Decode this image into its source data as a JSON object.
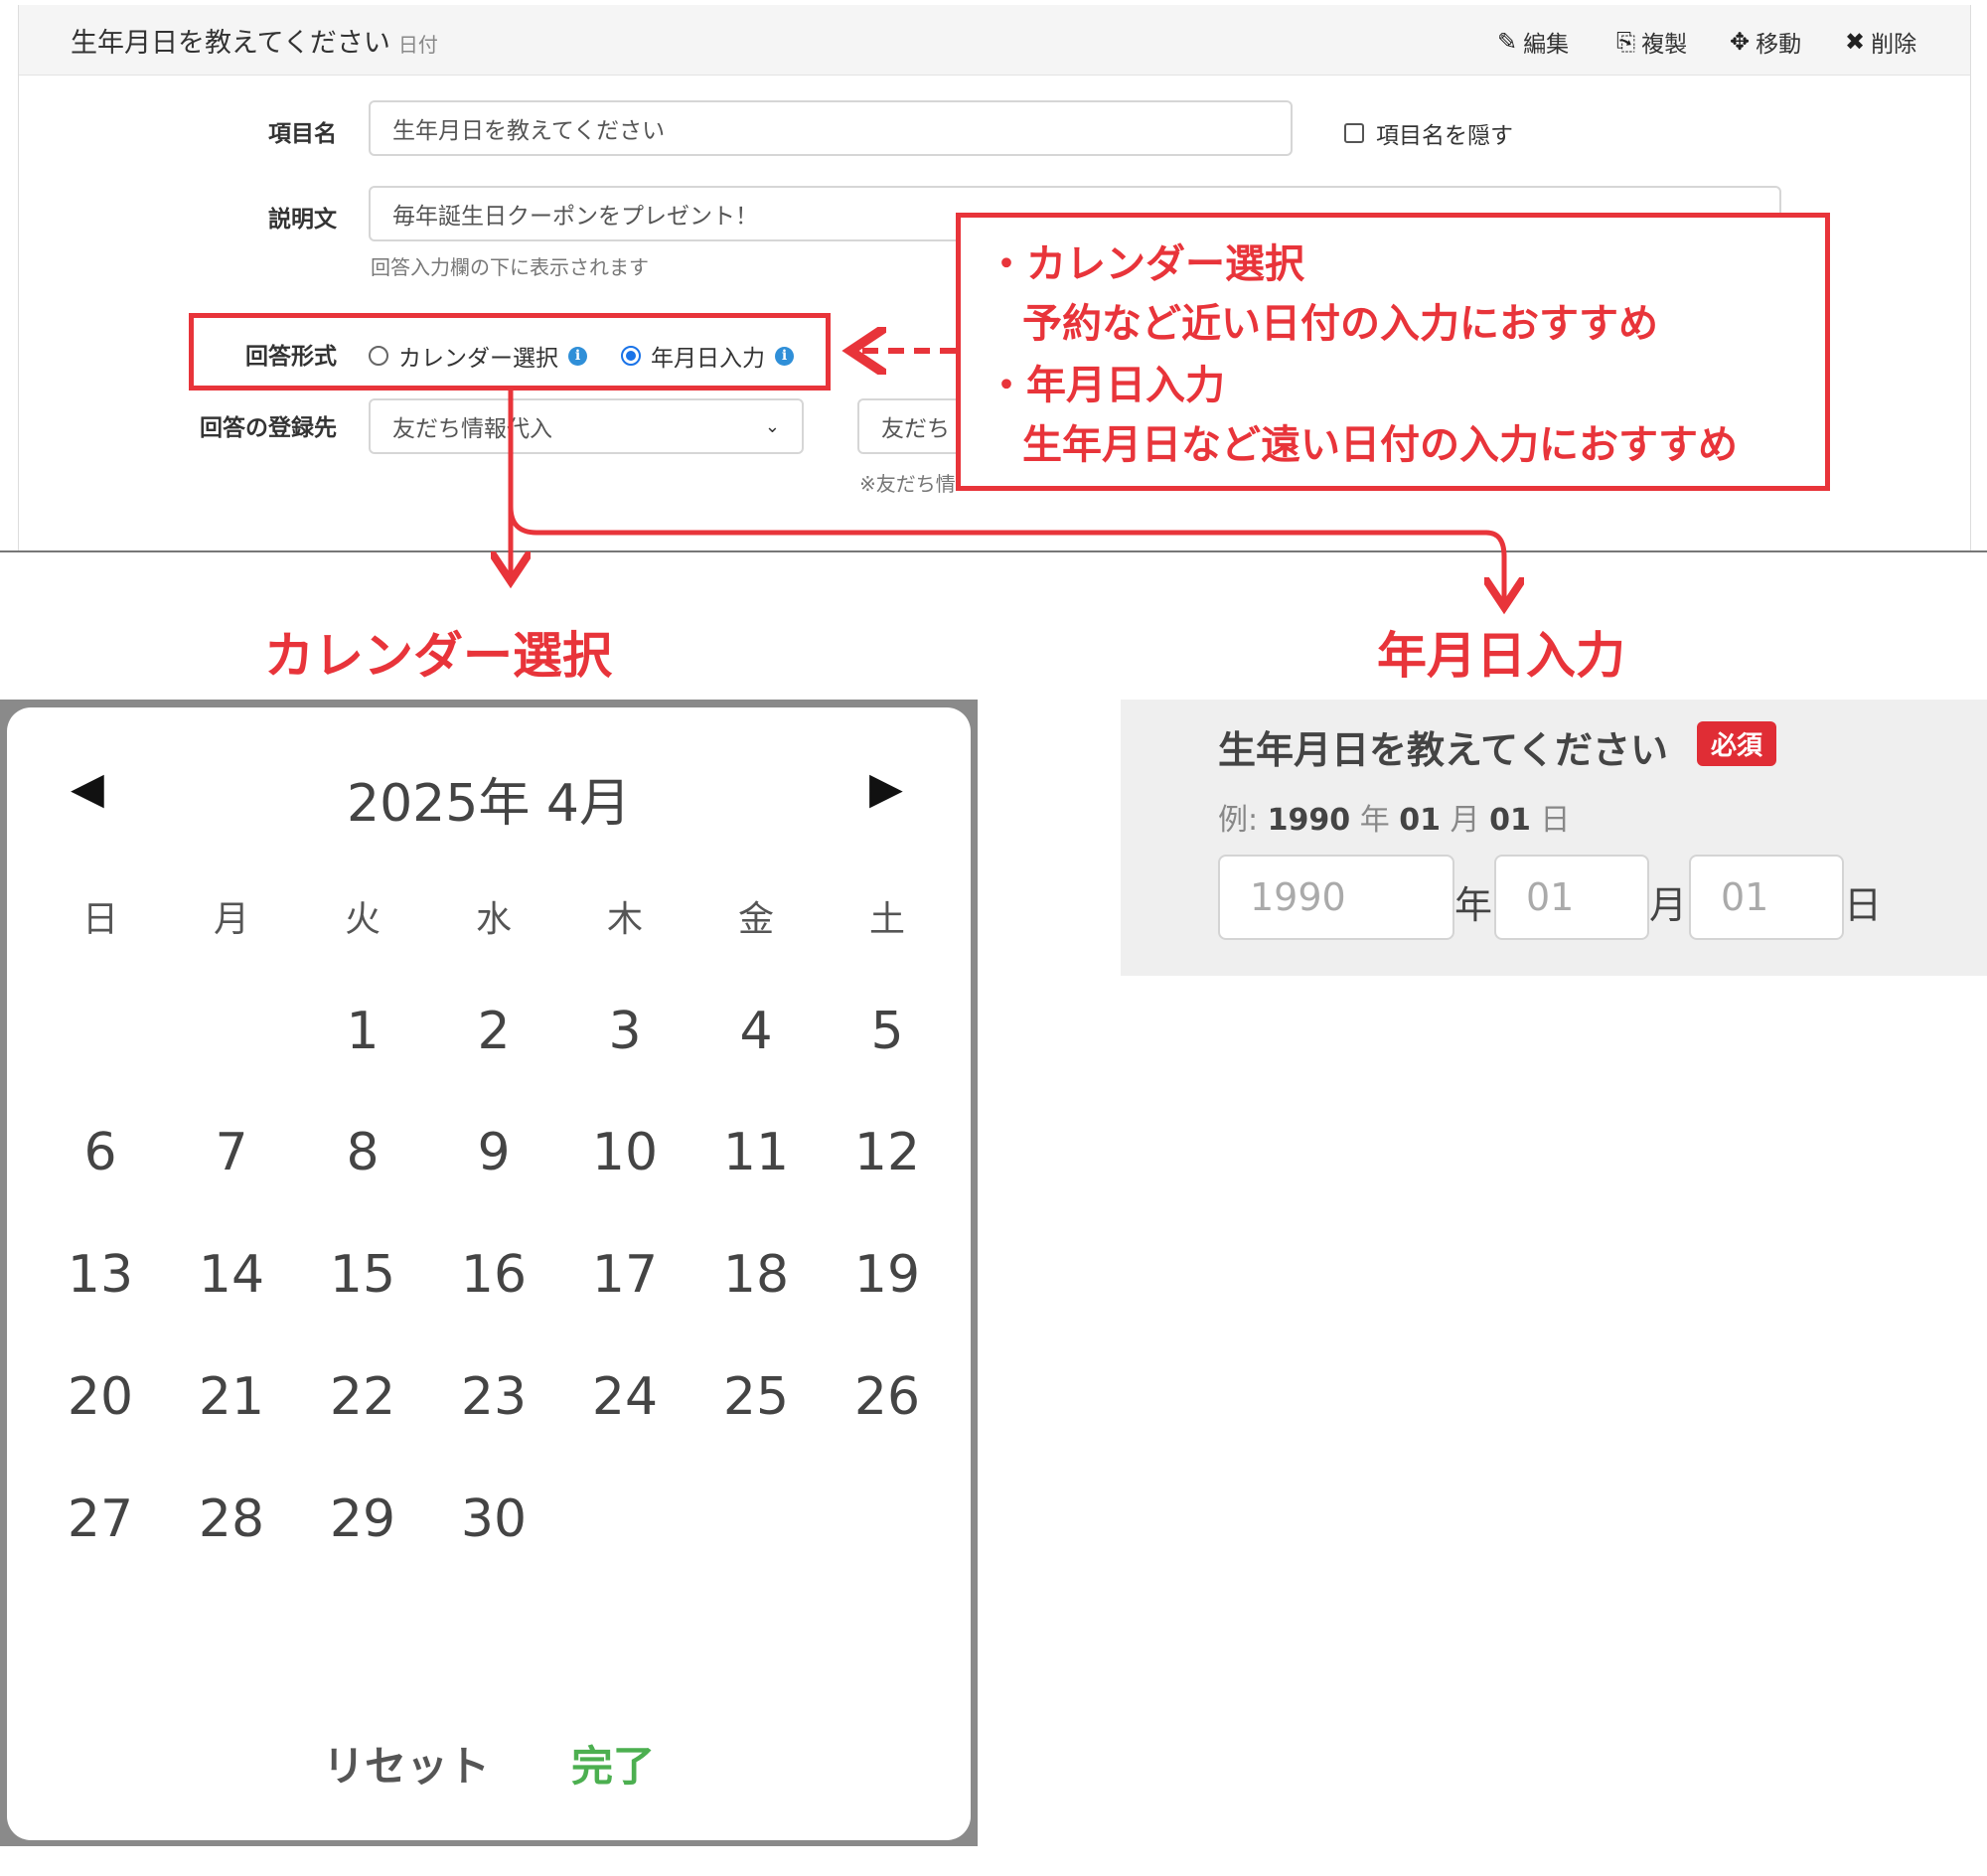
{
  "editor": {
    "title": "生年月日を教えてください",
    "type_label": "日付",
    "toolbar": {
      "edit": "編集",
      "duplicate": "複製",
      "move": "移動",
      "delete": "削除"
    },
    "item_name_label": "項目名",
    "item_name_value": "生年月日を教えてください",
    "hide_name_label": "項目名を隠す",
    "description_label": "説明文",
    "description_value": "毎年誕生日クーポンをプレゼント！",
    "description_hint": "回答入力欄の下に表示されます",
    "answer_format_label": "回答形式",
    "format_option_calendar": "カレンダー選択",
    "format_option_ymd": "年月日入力",
    "register_label": "回答の登録先",
    "register_select": "友だち情報代入",
    "register_field2": "友だち",
    "register_note": "※友だち情"
  },
  "callout": {
    "bullet1_title": "・カレンダー選択",
    "bullet1_desc": "予約など近い日付の入力におすすめ",
    "bullet2_title": "・年月日入力",
    "bullet2_desc": "生年月日など遠い日付の入力におすすめ"
  },
  "headings": {
    "calendar": "カレンダー選択",
    "ymd": "年月日入力"
  },
  "calendar": {
    "prev": "◀",
    "next": "▶",
    "title": "2025年 4月",
    "weekdays": [
      "日",
      "月",
      "火",
      "水",
      "木",
      "金",
      "土"
    ],
    "weeks": [
      [
        "",
        "",
        "1",
        "2",
        "3",
        "4",
        "5"
      ],
      [
        "6",
        "7",
        "8",
        "9",
        "10",
        "11",
        "12"
      ],
      [
        "13",
        "14",
        "15",
        "16",
        "17",
        "18",
        "19"
      ],
      [
        "20",
        "21",
        "22",
        "23",
        "24",
        "25",
        "26"
      ],
      [
        "27",
        "28",
        "29",
        "30",
        "",
        "",
        ""
      ]
    ],
    "reset": "リセット",
    "done": "完了",
    "done_color": "#4caf50"
  },
  "ymd_form": {
    "question": "生年月日を教えてください",
    "required": "必須",
    "example_prefix": "例:",
    "example_year": "1990",
    "example_year_unit": "年",
    "example_month": "01",
    "example_month_unit": "月",
    "example_day": "01",
    "example_day_unit": "日",
    "year_placeholder": "1990",
    "month_placeholder": "01",
    "day_placeholder": "01",
    "year_unit": "年",
    "month_unit": "月",
    "day_unit": "日"
  },
  "colors": {
    "accent_red": "#e8343a",
    "radio_blue": "#1a73e8",
    "required_red": "#e02d35"
  }
}
